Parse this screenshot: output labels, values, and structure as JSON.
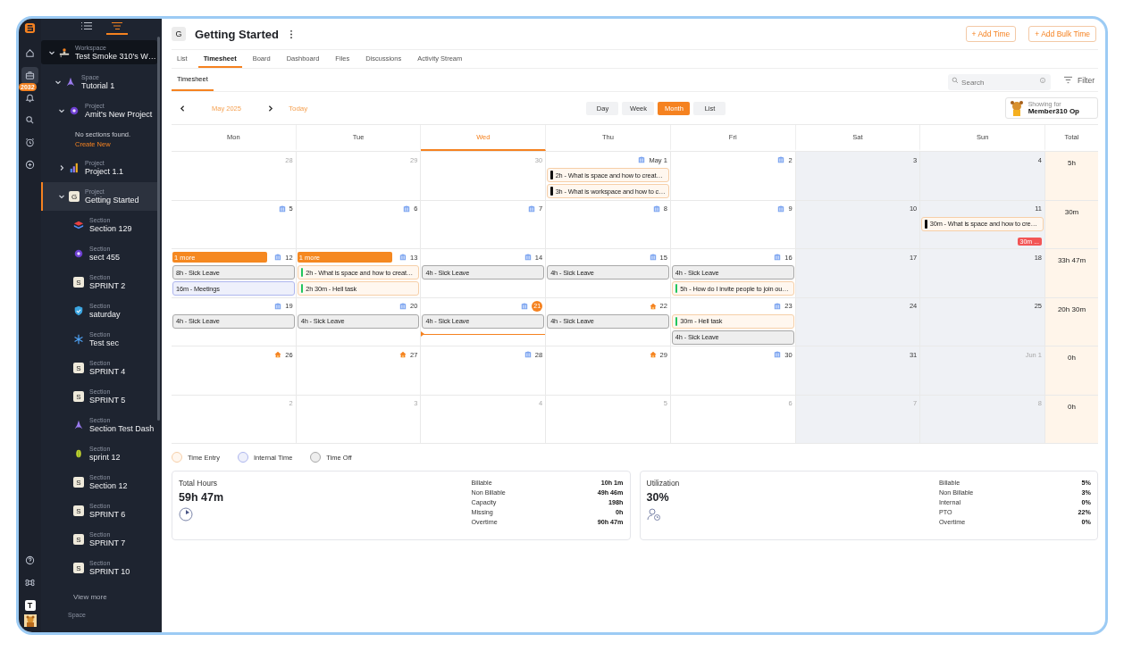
{
  "rail": {
    "badge": "2032",
    "avatar_letter": "T",
    "items": [
      {
        "kind": "home",
        "selected": false
      },
      {
        "kind": "briefcase",
        "selected": true
      },
      {
        "kind": "bell",
        "selected": false
      },
      {
        "kind": "search",
        "selected": false
      },
      {
        "kind": "alarm",
        "selected": false
      },
      {
        "kind": "plus",
        "selected": false
      }
    ]
  },
  "sidebar_views": [
    {
      "kind": "list",
      "selected": false
    },
    {
      "kind": "outline",
      "selected": true
    }
  ],
  "tree": {
    "node": {
      "type_label": "Workspace",
      "name": "Test Smoke 310's W…",
      "kind": "workspace",
      "expanded": true,
      "selected": false,
      "children": [
        {
          "type_label": "Space",
          "name": "Tutorial 1",
          "kind": "rocket",
          "expanded": true,
          "selected": false,
          "children": [
            {
              "type_label": "Project",
              "name": "Amit's New Project",
              "kind": "orb",
              "expanded": true,
              "selected": false,
              "empty_message": "No sections found.",
              "empty_action": "Create New"
            },
            {
              "type_label": "Project",
              "name": "Project 1.1",
              "kind": "bars",
              "expanded": false,
              "selected": false
            },
            {
              "type_label": "Project",
              "name": "Getting Started",
              "kind": "letter",
              "letter": "G",
              "expanded": true,
              "selected": true,
              "children": [
                {
                  "type_label": "Section",
                  "name": "Section 129",
                  "kind": "stack",
                  "selected": false
                },
                {
                  "type_label": "Section",
                  "name": "sect 455",
                  "kind": "orb",
                  "selected": false
                },
                {
                  "type_label": "Section",
                  "name": "SPRINT 2",
                  "kind": "letter",
                  "letter": "S",
                  "selected": false
                },
                {
                  "type_label": "Section",
                  "name": "saturday",
                  "kind": "shield",
                  "selected": false
                },
                {
                  "type_label": "Section",
                  "name": "Test sec",
                  "kind": "snow",
                  "selected": false
                },
                {
                  "type_label": "Section",
                  "name": "SPRINT 4",
                  "kind": "letter",
                  "letter": "S",
                  "selected": false
                },
                {
                  "type_label": "Section",
                  "name": "SPRINT 5",
                  "kind": "letter",
                  "letter": "S",
                  "selected": false
                },
                {
                  "type_label": "Section",
                  "name": "Section Test Dash",
                  "kind": "rocket",
                  "selected": false
                },
                {
                  "type_label": "Section",
                  "name": "sprint 12",
                  "kind": "leaf",
                  "selected": false
                },
                {
                  "type_label": "Section",
                  "name": "Section 12",
                  "kind": "letter",
                  "letter": "S",
                  "selected": false
                },
                {
                  "type_label": "Section",
                  "name": "SPRINT 6",
                  "kind": "letter",
                  "letter": "S",
                  "selected": false
                },
                {
                  "type_label": "Section",
                  "name": "SPRINT 7",
                  "kind": "letter",
                  "letter": "S",
                  "selected": false
                },
                {
                  "type_label": "Section",
                  "name": "SPRINT 10",
                  "kind": "letter",
                  "letter": "S",
                  "selected": false
                }
              ]
            }
          ]
        }
      ]
    },
    "view_more": "View more",
    "next_type_label": "Space"
  },
  "header": {
    "letter": "G",
    "title": "Getting Started",
    "buttons": [
      "+ Add Time",
      "+ Add Bulk Time"
    ]
  },
  "tabs": [
    {
      "label": "List",
      "selected": false
    },
    {
      "label": "Timesheet",
      "selected": true
    },
    {
      "label": "Board",
      "selected": false
    },
    {
      "label": "Dashboard",
      "selected": false
    },
    {
      "label": "Files",
      "selected": false
    },
    {
      "label": "Discussions",
      "selected": false
    },
    {
      "label": "Activity Stream",
      "selected": false
    }
  ],
  "subtabs": [
    {
      "label": "Timesheet",
      "selected": true
    }
  ],
  "search": {
    "placeholder": "Search"
  },
  "filter": "Filter",
  "nav": {
    "month": "May 2025",
    "today": "Today",
    "views": [
      {
        "label": "Day",
        "selected": false
      },
      {
        "label": "Week",
        "selected": false
      },
      {
        "label": "Month",
        "selected": true
      },
      {
        "label": "List",
        "selected": false
      }
    ],
    "showing_label": "Showing for",
    "member": "Member310 Op"
  },
  "calendar": {
    "days": [
      {
        "label": "Mon",
        "selected": false
      },
      {
        "label": "Tue",
        "selected": false
      },
      {
        "label": "Wed",
        "selected": true
      },
      {
        "label": "Thu",
        "selected": false
      },
      {
        "label": "Fri",
        "selected": false
      },
      {
        "label": "Sat",
        "selected": false
      },
      {
        "label": "Sun",
        "selected": false
      }
    ],
    "total_label": "Total",
    "weeks": [
      {
        "total": "5h",
        "cells": [
          {
            "date": "28",
            "outside": true
          },
          {
            "date": "29",
            "outside": true
          },
          {
            "date": "30",
            "outside": true
          },
          {
            "date": "May 1",
            "kind": "office",
            "entries": [
              {
                "kind": "time",
                "color": "#111111",
                "text": "2h - What is space and how to creat…"
              },
              {
                "kind": "time",
                "color": "#111111",
                "text": "3h - What is workspace and how to c…"
              }
            ]
          },
          {
            "date": "2",
            "kind": "office"
          },
          {
            "date": "3",
            "weekend": true
          },
          {
            "date": "4",
            "weekend": true
          }
        ]
      },
      {
        "total": "30m",
        "cells": [
          {
            "date": "5",
            "kind": "office"
          },
          {
            "date": "6",
            "kind": "office"
          },
          {
            "date": "7",
            "kind": "office"
          },
          {
            "date": "8",
            "kind": "office"
          },
          {
            "date": "9",
            "kind": "office"
          },
          {
            "date": "10",
            "weekend": true
          },
          {
            "date": "11",
            "weekend": true,
            "entries": [
              {
                "kind": "time",
                "color": "#111111",
                "text": "30m - What is space and how to cre…"
              }
            ],
            "badge": "30m ..."
          }
        ]
      },
      {
        "total": "33h 47m",
        "cells": [
          {
            "date": "12",
            "kind": "office",
            "more": "1 more",
            "entries": [
              {
                "kind": "off",
                "text": "8h - Sick Leave"
              },
              {
                "kind": "internal",
                "text": "16m - Meetings"
              }
            ]
          },
          {
            "date": "13",
            "kind": "office",
            "more": "1 more",
            "entries": [
              {
                "kind": "time",
                "color": "#22c55e",
                "text": "2h - What is space and how to creat…"
              },
              {
                "kind": "time",
                "color": "#22c55e",
                "text": "2h 30m - Hell task"
              }
            ]
          },
          {
            "date": "14",
            "kind": "office",
            "entries": [
              {
                "kind": "off",
                "text": "4h - Sick Leave"
              }
            ]
          },
          {
            "date": "15",
            "kind": "office",
            "entries": [
              {
                "kind": "off",
                "text": "4h - Sick Leave"
              }
            ]
          },
          {
            "date": "16",
            "kind": "office",
            "entries": [
              {
                "kind": "off",
                "text": "4h - Sick Leave"
              },
              {
                "kind": "time",
                "color": "#22c55e",
                "text": "5h - How do I invite people to join ou…"
              }
            ]
          },
          {
            "date": "17",
            "weekend": true
          },
          {
            "date": "18",
            "weekend": true
          }
        ]
      },
      {
        "total": "20h 30m",
        "cells": [
          {
            "date": "19",
            "kind": "office",
            "entries": [
              {
                "kind": "off",
                "text": "4h - Sick Leave"
              }
            ]
          },
          {
            "date": "20",
            "kind": "office",
            "entries": [
              {
                "kind": "off",
                "text": "4h - Sick Leave"
              }
            ]
          },
          {
            "date": "21",
            "kind": "office",
            "today": true,
            "entries": [
              {
                "kind": "off",
                "text": "4h - Sick Leave"
              }
            ]
          },
          {
            "date": "22",
            "kind": "home",
            "entries": [
              {
                "kind": "off",
                "text": "4h - Sick Leave"
              }
            ]
          },
          {
            "date": "23",
            "kind": "office",
            "entries": [
              {
                "kind": "time",
                "color": "#22c55e",
                "text": "30m - Hell task"
              },
              {
                "kind": "off",
                "text": "4h - Sick Leave"
              }
            ]
          },
          {
            "date": "24",
            "weekend": true
          },
          {
            "date": "25",
            "weekend": true
          }
        ]
      },
      {
        "total": "0h",
        "cells": [
          {
            "date": "26",
            "kind": "home"
          },
          {
            "date": "27",
            "kind": "home"
          },
          {
            "date": "28",
            "kind": "office"
          },
          {
            "date": "29",
            "kind": "home"
          },
          {
            "date": "30",
            "kind": "office"
          },
          {
            "date": "31",
            "weekend": true
          },
          {
            "date": "Jun 1",
            "weekend": true,
            "outside": true
          }
        ]
      },
      {
        "total": "0h",
        "cells": [
          {
            "date": "2",
            "outside": true
          },
          {
            "date": "3",
            "outside": true
          },
          {
            "date": "4",
            "outside": true
          },
          {
            "date": "5",
            "outside": true
          },
          {
            "date": "6",
            "outside": true
          },
          {
            "date": "7",
            "weekend": true,
            "outside": true
          },
          {
            "date": "8",
            "weekend": true,
            "outside": true
          }
        ]
      }
    ]
  },
  "legend": [
    {
      "kind": "time",
      "label": "Time Entry"
    },
    {
      "kind": "internal",
      "label": "Internal Time"
    },
    {
      "kind": "off",
      "label": "Time Off"
    }
  ],
  "cards": [
    {
      "title": "Total Hours",
      "value": "59h 47m",
      "kind": "pie",
      "stats": [
        {
          "label": "Billable",
          "value": "10h 1m"
        },
        {
          "label": "Non Billable",
          "value": "49h 46m"
        },
        {
          "label": "Capacity",
          "value": "198h"
        },
        {
          "label": "Missing",
          "value": "0h"
        },
        {
          "label": "Overtime",
          "value": "90h 47m"
        }
      ]
    },
    {
      "title": "Utilization",
      "value": "30%",
      "kind": "person-clock",
      "stats": [
        {
          "label": "Billable",
          "value": "5%"
        },
        {
          "label": "Non Billable",
          "value": "3%"
        },
        {
          "label": "Internal",
          "value": "0%"
        },
        {
          "label": "PTO",
          "value": "22%"
        },
        {
          "label": "Overtime",
          "value": "0%"
        }
      ]
    }
  ]
}
